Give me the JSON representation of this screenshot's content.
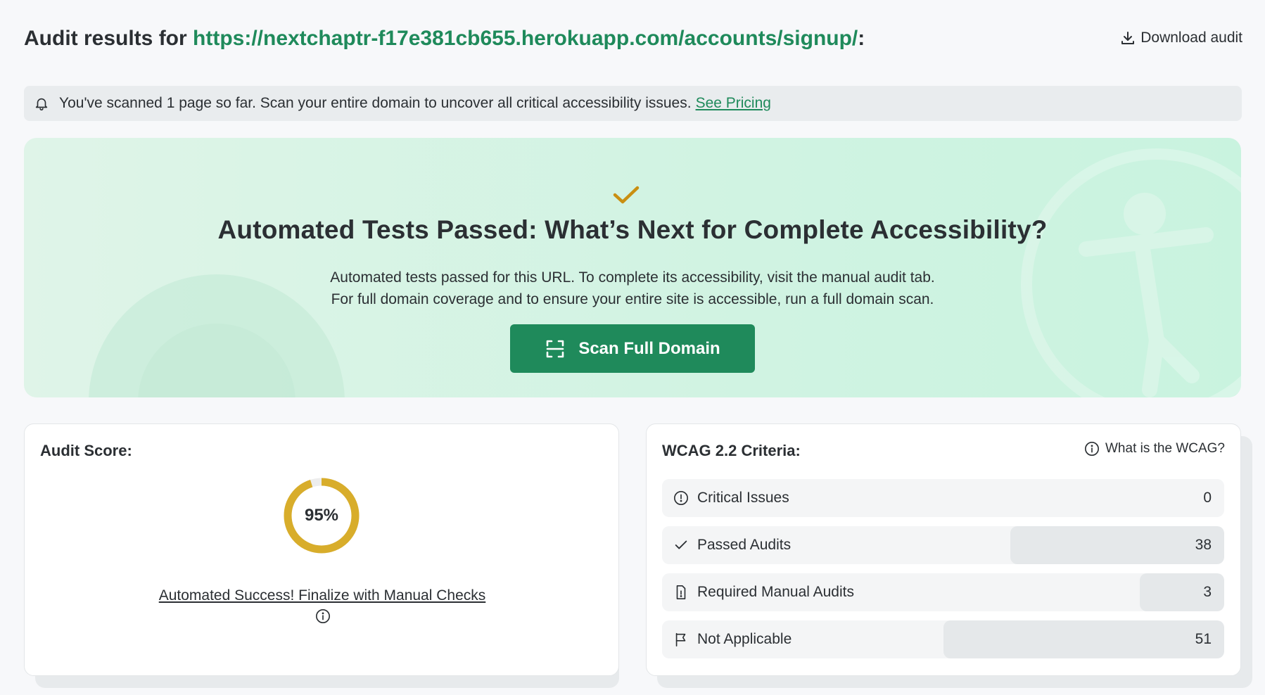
{
  "header": {
    "title_prefix": "Audit results for ",
    "url": "https://nextchaptr-f17e381cb655.herokuapp.com/accounts/signup/",
    "title_suffix": ":",
    "download_label": "Download audit"
  },
  "notice": {
    "text": "You've scanned 1 page so far. Scan your entire domain to uncover all critical accessibility issues.",
    "link": "See Pricing"
  },
  "hero": {
    "heading": "Automated Tests Passed: What’s Next for Complete Accessibility?",
    "line1": "Automated tests passed for this URL. To complete its accessibility, visit the manual audit tab.",
    "line2": "For full domain coverage and to ensure your entire site is accessible, run a full domain scan.",
    "button": "Scan Full Domain"
  },
  "score_card": {
    "title": "Audit Score:",
    "score": 95,
    "score_label": "95%",
    "link_text": "Automated Success! Finalize with Manual Checks",
    "ring_color": "#d8ad2b"
  },
  "wcag_card": {
    "title": "WCAG 2.2 Criteria:",
    "help": "What is the WCAG?",
    "rows": [
      {
        "label": "Critical Issues",
        "value": "0",
        "icon": "alert-circle-icon",
        "fraction": 0
      },
      {
        "label": "Passed Audits",
        "value": "38",
        "icon": "check-icon",
        "fraction": 0.38
      },
      {
        "label": "Required Manual Audits",
        "value": "3",
        "icon": "document-icon",
        "fraction": 0.15
      },
      {
        "label": "Not Applicable",
        "value": "51",
        "icon": "flag-icon",
        "fraction": 0.5
      }
    ]
  },
  "colors": {
    "brand_green": "#1f8a5b",
    "ring": "#d8ad2b",
    "check": "#c98f12"
  }
}
